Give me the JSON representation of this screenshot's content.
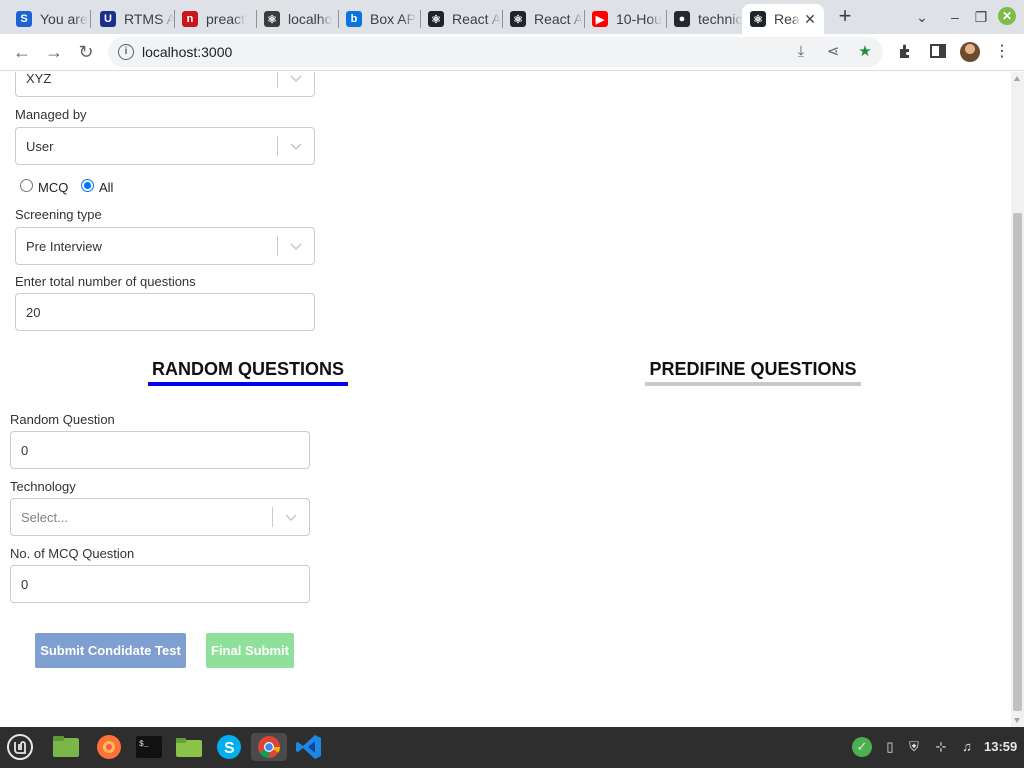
{
  "browser": {
    "tabs": [
      {
        "label": "You are",
        "favicon": "s-icon",
        "color": "#1e63d6",
        "glyph": "S"
      },
      {
        "label": "RTMS A",
        "favicon": "u-icon",
        "color": "#1c2f8c",
        "glyph": "U"
      },
      {
        "label": "preact",
        "favicon": "preact-icon",
        "color": "#c9161d",
        "glyph": "n"
      },
      {
        "label": "localho",
        "favicon": "react-icon",
        "color": "#3b3b3b",
        "glyph": "⚛"
      },
      {
        "label": "Box AP",
        "favicon": "box-icon",
        "color": "#0b73e0",
        "glyph": "b"
      },
      {
        "label": "React A",
        "favicon": "react-icon",
        "color": "#20232a",
        "glyph": "⚛"
      },
      {
        "label": "React A",
        "favicon": "react-icon",
        "color": "#20232a",
        "glyph": "⚛"
      },
      {
        "label": "10-Hou",
        "favicon": "youtube-icon",
        "color": "#ff0000",
        "glyph": "▶"
      },
      {
        "label": "technic",
        "favicon": "github-icon",
        "color": "#24292e",
        "glyph": "●"
      },
      {
        "label": "Rea",
        "favicon": "react-icon",
        "color": "#20232a",
        "glyph": "⚛"
      }
    ],
    "active_tab_index": 9,
    "url": "localhost:3000"
  },
  "form": {
    "company_select_value": "XYZ",
    "managed_by_label": "Managed by",
    "managed_by_value": "User",
    "radio_mcq_label": "MCQ",
    "radio_all_label": "All",
    "radio_selected": "All",
    "screening_type_label": "Screening type",
    "screening_type_value": "Pre Interview",
    "total_questions_label": "Enter total number of questions",
    "total_questions_value": "20"
  },
  "section_tabs": {
    "random_label": "RANDOM QUESTIONS",
    "predefine_label": "PREDIFINE QUESTIONS",
    "active": "random",
    "active_color": "#0000ee",
    "inactive_color": "#c8c8c8"
  },
  "random_section": {
    "random_question_label": "Random Question",
    "random_question_value": "0",
    "technology_label": "Technology",
    "technology_placeholder": "Select...",
    "mcq_count_label": "No. of MCQ Question",
    "mcq_count_value": "0"
  },
  "buttons": {
    "submit_label": "Submit Condidate Test",
    "submit_color": "#7f9fd1",
    "final_label": "Final Submit",
    "final_color": "#8fe09a"
  },
  "taskbar": {
    "clock": "13:59",
    "apps": [
      "mint-menu-icon",
      "files-icon",
      "firefox-icon",
      "terminal-icon",
      "folder-icon",
      "skype-icon",
      "chrome-icon",
      "vscode-icon"
    ]
  }
}
